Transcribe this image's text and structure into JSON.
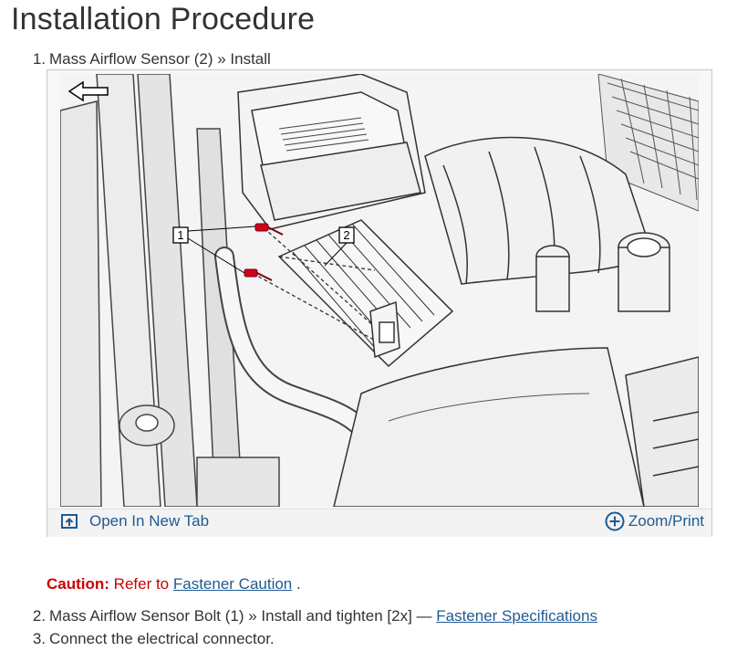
{
  "page": {
    "title": "Installation Procedure"
  },
  "steps": [
    {
      "number": "1.",
      "text": "Mass Airflow Sensor (2) » Install"
    },
    {
      "number": "2.",
      "text": "Mass Airflow Sensor Bolt (1) » Install and tighten [2x] — ",
      "link": "Fastener Specifications"
    },
    {
      "number": "3.",
      "text": "Connect the electrical connector."
    }
  ],
  "figure": {
    "callouts": [
      "1",
      "2"
    ],
    "open_tab_label": "Open In New Tab",
    "zoom_print_label": "Zoom/Print",
    "open_tab_icon": "open-in-new-tab-icon",
    "zoom_icon": "zoom-plus-icon",
    "back_icon": "back-arrow-icon"
  },
  "caution": {
    "label": "Caution:",
    "text": " Refer to ",
    "link": "Fastener Caution",
    "suffix": " ."
  },
  "colors": {
    "link": "#1f5a92",
    "caution": "#cc0000",
    "bolt": "#d0021b"
  }
}
